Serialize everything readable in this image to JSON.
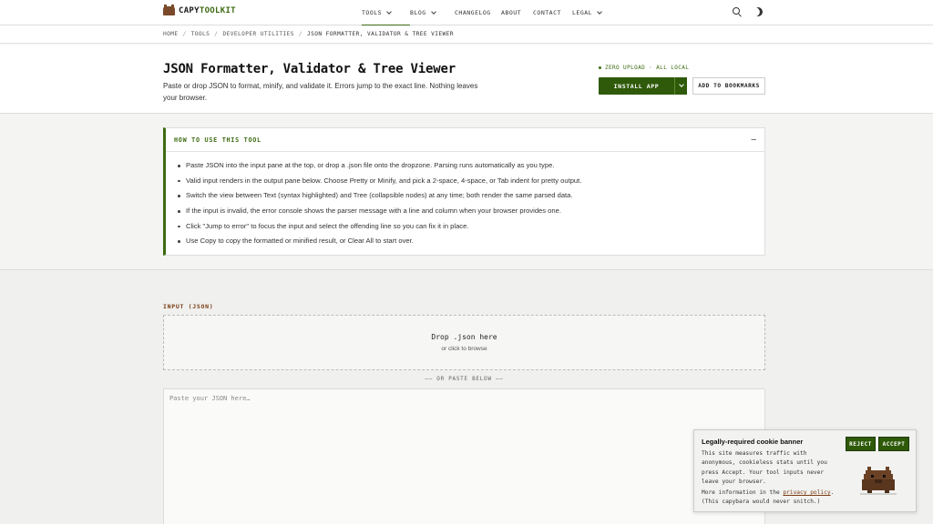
{
  "brand": {
    "part1": "CAPY",
    "part2": "TOOLKIT"
  },
  "nav": {
    "items": [
      {
        "label": "TOOLS",
        "has_menu": true,
        "active": true
      },
      {
        "label": "BLOG",
        "has_menu": true,
        "active": false
      },
      {
        "label": "CHANGELOG",
        "has_menu": false,
        "active": false
      },
      {
        "label": "ABOUT",
        "has_menu": false,
        "active": false
      },
      {
        "label": "CONTACT",
        "has_menu": false,
        "active": false
      },
      {
        "label": "LEGAL",
        "has_menu": true,
        "active": false
      }
    ]
  },
  "breadcrumb": [
    "HOME",
    "TOOLS",
    "DEVELOPER UTILITIES",
    "JSON FORMATTER, VALIDATOR & TREE VIEWER"
  ],
  "header": {
    "title": "JSON Formatter, Validator & Tree Viewer",
    "description": "Paste or drop JSON to format, minify, and validate it. Errors jump to the exact line. Nothing leaves your browser.",
    "privacy_note": "ZERO UPLOAD · ALL LOCAL",
    "install_label": "INSTALL APP",
    "bookmark_label": "ADD TO BOOKMARKS"
  },
  "howto": {
    "title": "HOW TO USE THIS TOOL",
    "toggle": "–",
    "steps": [
      "Paste JSON into the input pane at the top, or drop a .json file onto the dropzone. Parsing runs automatically as you type.",
      "Valid input renders in the output pane below. Choose Pretty or Minify, and pick a 2-space, 4-space, or Tab indent for pretty output.",
      "Switch the view between Text (syntax highlighted) and Tree (collapsible nodes) at any time; both render the same parsed data.",
      "If the input is invalid, the error console shows the parser message with a line and column when your browser provides one.",
      "Click \"Jump to error\" to focus the input and select the offending line so you can fix it in place.",
      "Use Copy to copy the formatted or minified result, or Clear All to start over."
    ]
  },
  "input": {
    "label": "INPUT (JSON)",
    "dropzone_title": "Drop .json here",
    "dropzone_sub": "or click to browse",
    "divider": "—— OR PASTE BELOW ——",
    "placeholder": "Paste your JSON here…",
    "value": ""
  },
  "cookie": {
    "title": "Legally-required cookie banner",
    "body": "This site measures traffic with anonymous, cookieless stats until you press Accept. Your tool inputs never leave your browser.",
    "more_prefix": "More information in the ",
    "link": "privacy policy",
    "more_suffix": ". (This capybara would never snitch.)",
    "reject": "REJECT",
    "accept": "ACCEPT"
  },
  "colors": {
    "accent": "#2f5a0a",
    "accent_text": "#3d6b12",
    "label_brown": "#7a3b12",
    "capybara": "#6b4226"
  }
}
